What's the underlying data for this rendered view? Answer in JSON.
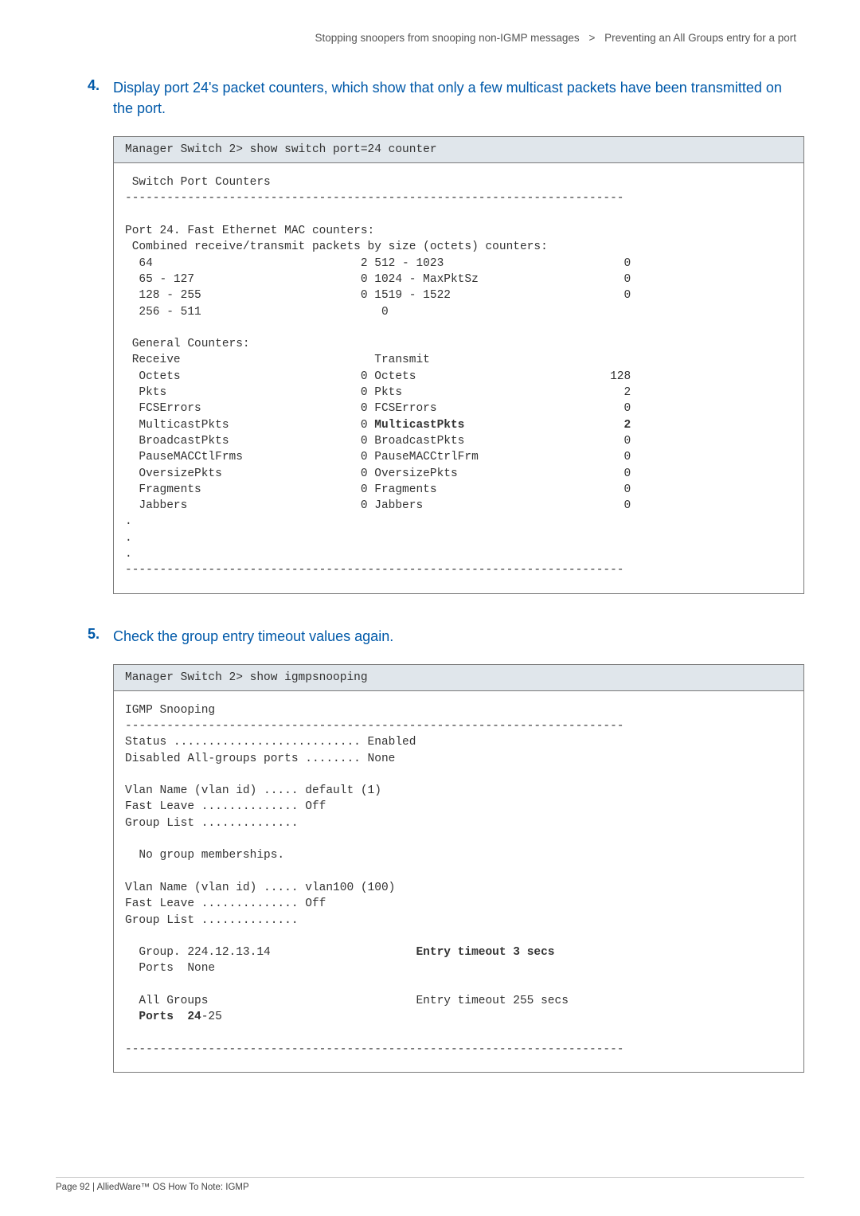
{
  "breadcrumb": {
    "left": "Stopping snoopers from snooping non-IGMP messages",
    "right": "Preventing an All Groups entry for a port"
  },
  "step4": {
    "num": "4.",
    "text": "Display port 24's packet counters, which show that only a few multicast packets have been transmitted on the port."
  },
  "term1": {
    "cmd": "Manager Switch 2> show switch port=24 counter",
    "l01": " Switch Port Counters",
    "l02": "------------------------------------------------------------------------",
    "l03": "Port 24. Fast Ethernet MAC counters:",
    "l04": " Combined receive/transmit packets by size (octets) counters:",
    "l05": "  64                              2 512 - 1023                          0",
    "l06": "  65 - 127                        0 1024 - MaxPktSz                     0",
    "l07": "  128 - 255                       0 1519 - 1522                         0",
    "l08": "  256 - 511                          0",
    "l09": " General Counters:",
    "l10": " Receive                            Transmit",
    "l11": "  Octets                          0 Octets                            128",
    "l12": "  Pkts                            0 Pkts                                2",
    "l13": "  FCSErrors                       0 FCSErrors                           0",
    "l14a": "  MulticastPkts                   0 ",
    "l14b": "MulticastPkts                       2",
    "l15": "  BroadcastPkts                   0 BroadcastPkts                       0",
    "l16": "  PauseMACCtlFrms                 0 PauseMACCtrlFrm                     0",
    "l17": "  OversizePkts                    0 OversizePkts                        0",
    "l18": "  Fragments                       0 Fragments                           0",
    "l19": "  Jabbers                         0 Jabbers                             0",
    "l20": ".",
    "l21": ".",
    "l22": ".",
    "l23": "------------------------------------------------------------------------"
  },
  "step5": {
    "num": "5.",
    "text": "Check the group entry timeout values again."
  },
  "term2": {
    "cmd": "Manager Switch 2> show igmpsnooping",
    "l01": "IGMP Snooping",
    "l02": "------------------------------------------------------------------------",
    "l03": "Status ........................... Enabled",
    "l04": "Disabled All-groups ports ........ None",
    "l05": "Vlan Name (vlan id) ..... default (1)",
    "l06": "Fast Leave .............. Off",
    "l07": "Group List ..............",
    "l08": "  No group memberships.",
    "l09": "Vlan Name (vlan id) ..... vlan100 (100)",
    "l10": "Fast Leave .............. Off",
    "l11": "Group List ..............",
    "l12a": "  Group. 224.12.13.14                     ",
    "l12b": "Entry timeout 3 secs",
    "l13": "  Ports  None",
    "l14": "  All Groups                              Entry timeout 255 secs",
    "l15a": "  ",
    "l15b": "Ports  24",
    "l15c": "-25",
    "l16": "------------------------------------------------------------------------"
  },
  "footer": "Page 92 | AlliedWare™ OS How To Note: IGMP"
}
